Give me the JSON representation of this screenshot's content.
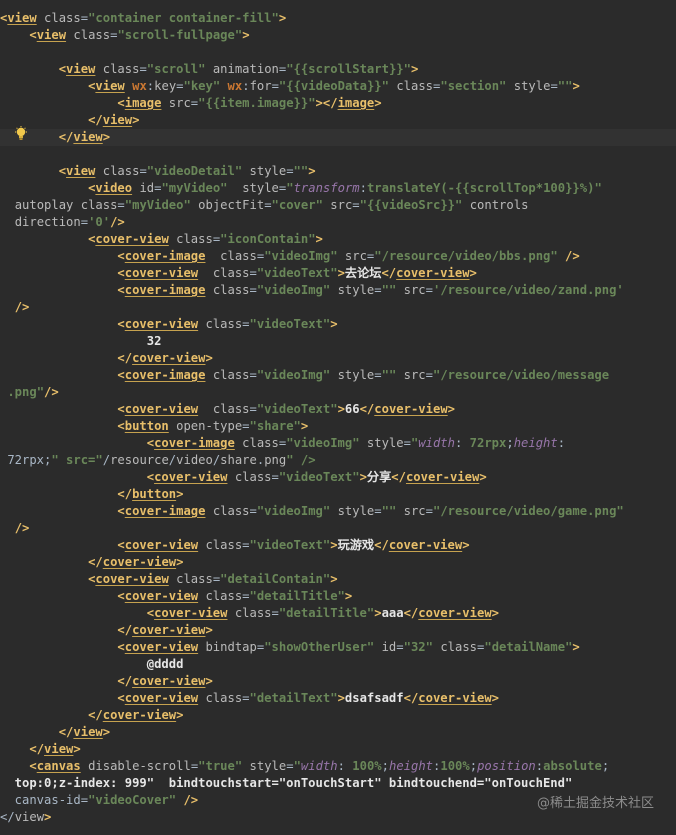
{
  "editor": {
    "theme_bg": "#2b2b2b",
    "current_line_bg": "#323232",
    "tag_color": "#e8bf6a",
    "string_color": "#6a8759",
    "css_key_color": "#9876aa",
    "lines": [
      "<view class=\"container container-fill\">",
      "    <view class=\"scroll-fullpage\">",
      "",
      "        <view class=\"scroll\" animation=\"{{scrollStart}}\">",
      "            <view wx:key=\"key\" wx:for=\"{{videoData}}\" class=\"section\" style=\"\">",
      "                <image src=\"{{item.image}}\"></image>",
      "            </view>",
      "        </view>",
      "",
      "        <view class=\"videoDetail\" style=\"\">",
      "            <video id=\"myVideo\"  style=\"transform:translateY(-{{scrollTop*100}}%)\"",
      "  autoplay class=\"myVideo\" objectFit=\"cover\" src=\"{{videoSrc}}\" controls",
      "  direction='0'/>",
      "            <cover-view class=\"iconContain\">",
      "                <cover-image  class=\"videoImg\" src=\"/resource/video/bbs.png\" />",
      "                <cover-view  class=\"videoText\">去论坛</cover-view>",
      "                <cover-image class=\"videoImg\" style=\"\" src='/resource/video/zand.png'",
      "  />",
      "                <cover-view class=\"videoText\">",
      "                    32",
      "                </cover-view>",
      "                <cover-image class=\"videoImg\" style=\"\" src=\"/resource/video/message",
      " .png\"/>",
      "                <cover-view  class=\"videoText\">66</cover-view>",
      "                <button open-type=\"share\">",
      "                    <cover-image class=\"videoImg\" style=\"width: 72rpx;height:",
      " 72rpx;\" src=\"/resource/video/share.png\" />",
      "                    <cover-view class=\"videoText\">分享</cover-view>",
      "                </button>",
      "                <cover-image class=\"videoImg\" style=\"\" src=\"/resource/video/game.png\"",
      "  />",
      "                <cover-view class=\"videoText\">玩游戏</cover-view>",
      "            </cover-view>",
      "            <cover-view class=\"detailContain\">",
      "                <cover-view class=\"detailTitle\">",
      "                    <cover-view class=\"detailTitle\">aaa</cover-view>",
      "                </cover-view>",
      "                <cover-view bindtap=\"showOtherUser\" id=\"32\" class=\"detailName\">",
      "                    @dddd",
      "                </cover-view>",
      "                <cover-view class=\"detailText\">dsafsadf</cover-view>",
      "            </cover-view>",
      "        </view>",
      "    </view>",
      "    <canvas disable-scroll=\"true\" style=\"width: 100%;height:100%;position:absolute;",
      "  top:0;z-index: 999\"  bindtouchstart=\"onTouchStart\" bindtouchend=\"onTouchEnd\"",
      "  canvas-id=\"videoCover\" />",
      "</view>"
    ]
  },
  "gutter": {
    "intention_icon": "lightbulb-icon"
  },
  "watermark": {
    "text": "@稀土掘金技术社区"
  }
}
